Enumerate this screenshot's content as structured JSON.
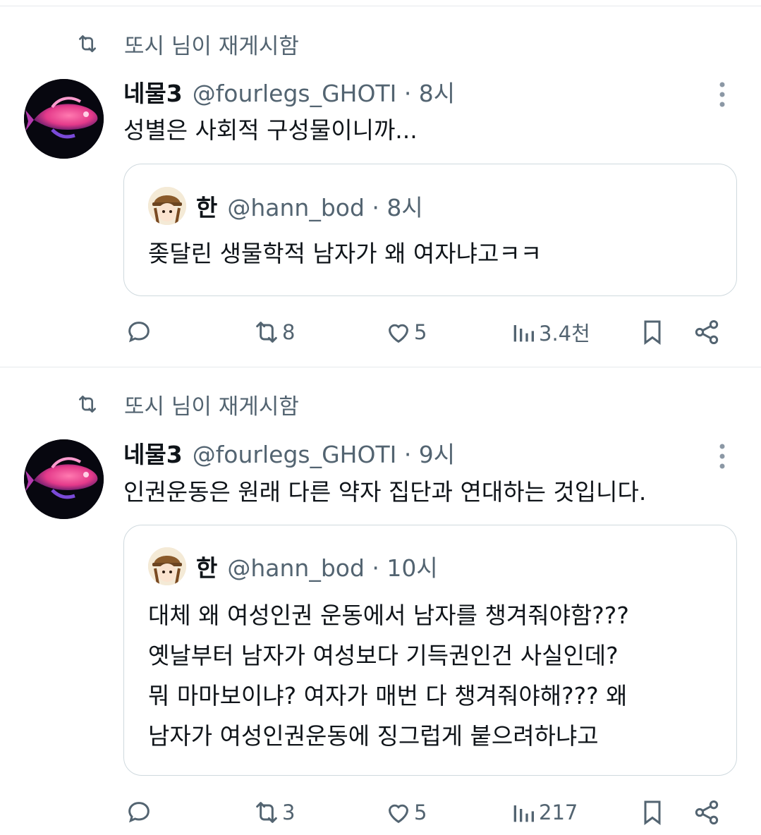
{
  "tweets": [
    {
      "repost_label": "또시 님이 재게시함",
      "author_name": "네물3",
      "handle_time": "@fourlegs_GHOTI · 8시",
      "text": "성별은 사회적 구성물이니까...",
      "quote": {
        "author_name": "한",
        "handle_time": "@hann_bod · 8시",
        "lines": [
          "좆달린 생물학적 남자가 왜 여자냐고ㅋㅋ"
        ]
      },
      "stats": {
        "reposts": "8",
        "likes": "5",
        "views": "3.4천"
      }
    },
    {
      "repost_label": "또시 님이 재게시함",
      "author_name": "네물3",
      "handle_time": "@fourlegs_GHOTI · 9시",
      "text": "인권운동은 원래 다른 약자 집단과 연대하는 것입니다.",
      "quote": {
        "author_name": "한",
        "handle_time": "@hann_bod · 10시",
        "lines": [
          "대체 왜 여성인권 운동에서 남자를 챙겨줘야함???",
          "옛날부터 남자가 여성보다 기득권인건 사실인데?",
          "뭐 마마보이냐? 여자가 매번 다 챙겨줘야해??? 왜",
          "남자가 여성인권운동에 징그럽게 붙으려하냐고"
        ]
      },
      "stats": {
        "reposts": "3",
        "likes": "5",
        "views": "217"
      }
    }
  ],
  "colors": {
    "text": "#0f1419",
    "secondary": "#536471",
    "border": "#cfd9de"
  },
  "icons": [
    "repost-icon",
    "more-icon",
    "reply-icon",
    "like-icon",
    "views-icon",
    "bookmark-icon",
    "share-icon"
  ]
}
